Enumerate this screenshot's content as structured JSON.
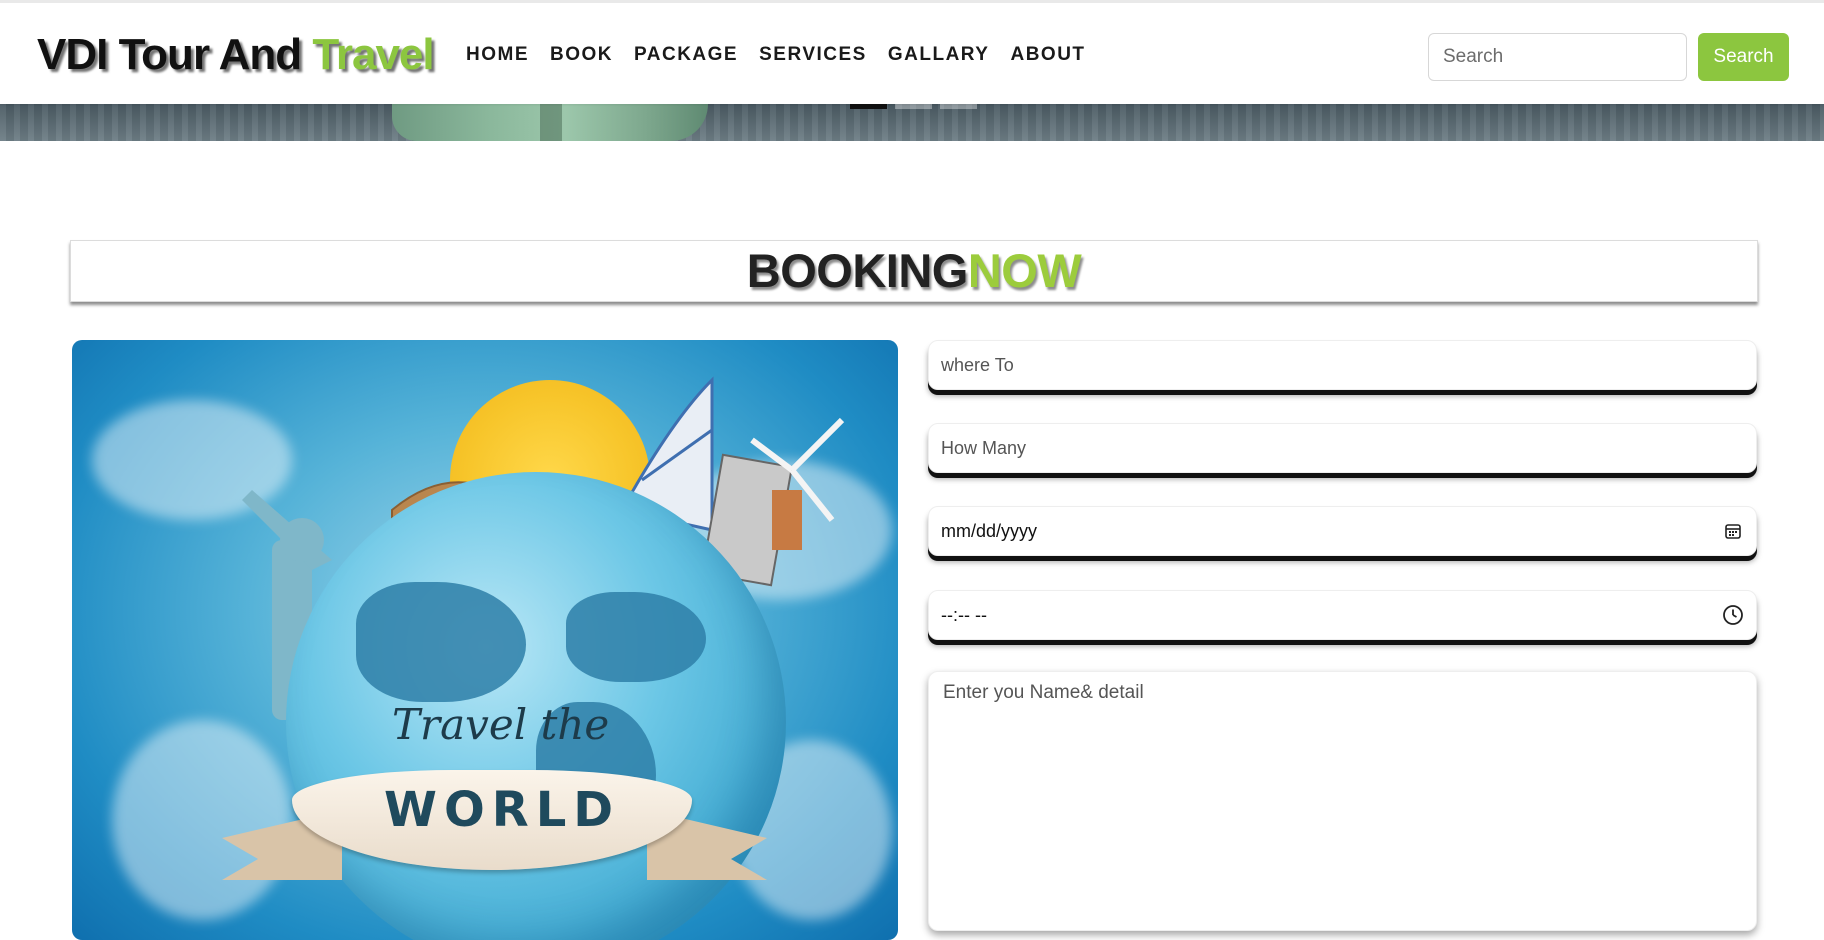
{
  "brand": {
    "part1": "VDI Tour And ",
    "part2": "Travel"
  },
  "nav": {
    "items": [
      {
        "label": "HOME"
      },
      {
        "label": "BOOK"
      },
      {
        "label": "PACKAGE"
      },
      {
        "label": "SERVICES"
      },
      {
        "label": "GALLARY"
      },
      {
        "label": "ABOUT"
      }
    ]
  },
  "search": {
    "placeholder": "Search",
    "button_label": "Search"
  },
  "carousel": {
    "indicator_count": 3,
    "active_index": 0
  },
  "booking": {
    "title_part1": "BOOKING",
    "title_part2": "NOW",
    "image_caption_top": "Travel the",
    "image_caption_bottom": "WORLD",
    "fields": {
      "where_to": {
        "placeholder": "where To"
      },
      "how_many": {
        "placeholder": "How Many"
      },
      "date": {
        "value": "mm/dd/yyyy",
        "icon": "calendar-icon"
      },
      "time": {
        "value": "--:-- --",
        "icon": "clock-icon"
      },
      "details": {
        "placeholder": "Enter you Name& detail"
      }
    }
  },
  "colors": {
    "accent_green": "#8cc63f",
    "title_green": "#9ccc3c",
    "text_dark": "#111111"
  }
}
